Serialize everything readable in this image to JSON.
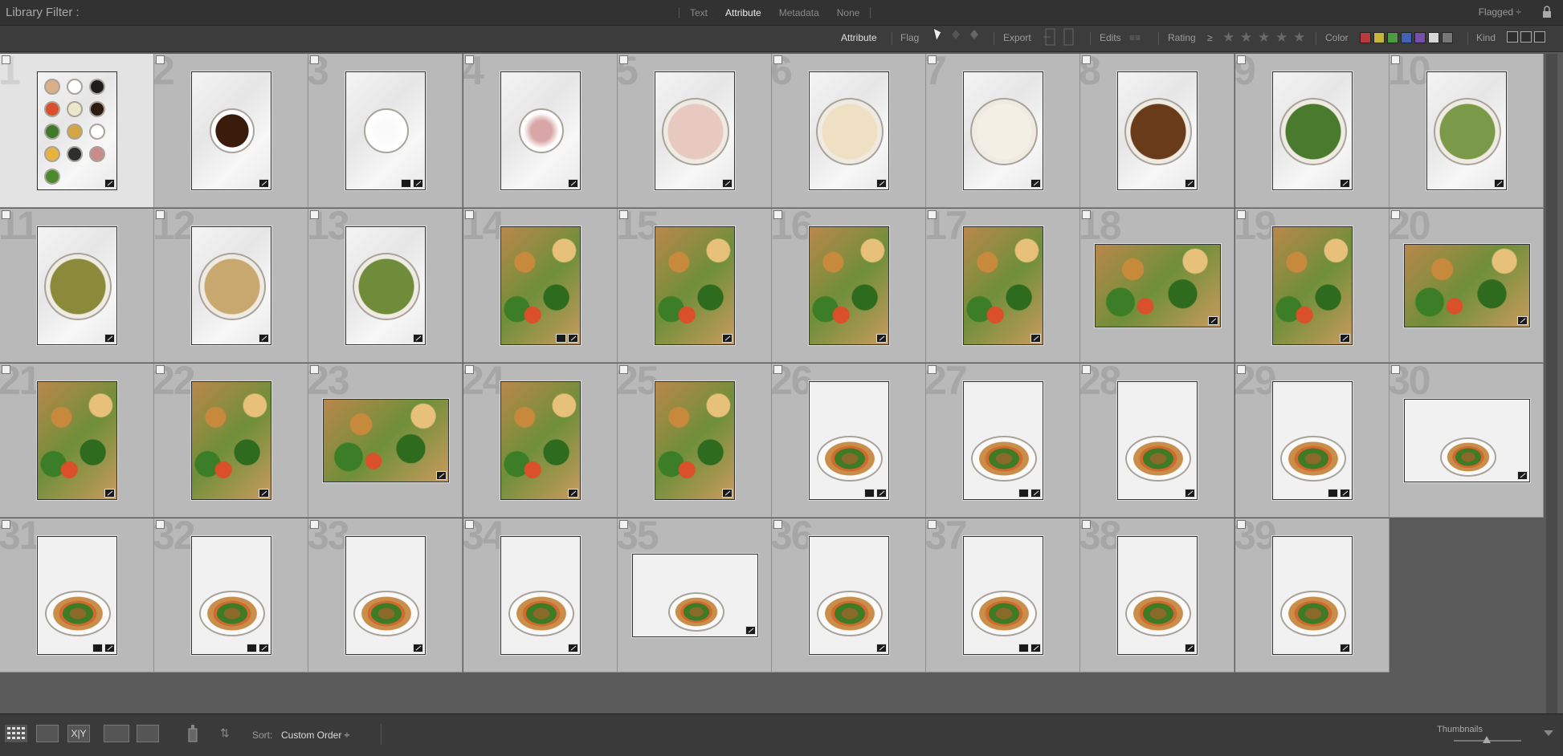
{
  "filter_bar": {
    "title": "Library Filter :",
    "tabs": [
      {
        "label": "Text",
        "active": false
      },
      {
        "label": "Attribute",
        "active": true
      },
      {
        "label": "Metadata",
        "active": false
      },
      {
        "label": "None",
        "active": false
      }
    ],
    "preset": "Flagged ÷"
  },
  "attribute_bar": {
    "label": "Attribute",
    "flag": "Flag",
    "export": "Export",
    "edits": "Edits",
    "rating": "Rating",
    "rating_op": "≥",
    "color": "Color",
    "kind": "Kind",
    "colors": [
      "#b73b3b",
      "#c9b43a",
      "#4e9a3f",
      "#3f63b5",
      "#7a4fa8",
      "#d6d6d6",
      "#777777"
    ]
  },
  "grid": {
    "cells": [
      {
        "n": "1",
        "kind": "ingredients",
        "selected": true
      },
      {
        "n": "2",
        "kind": "marble"
      },
      {
        "n": "3",
        "kind": "marble"
      },
      {
        "n": "4",
        "kind": "marble"
      },
      {
        "n": "5",
        "kind": "bowl"
      },
      {
        "n": "6",
        "kind": "bowl"
      },
      {
        "n": "7",
        "kind": "bowl"
      },
      {
        "n": "8",
        "kind": "bowl"
      },
      {
        "n": "9",
        "kind": "bowl"
      },
      {
        "n": "10",
        "kind": "bowl"
      },
      {
        "n": "11",
        "kind": "bowl"
      },
      {
        "n": "12",
        "kind": "bowl"
      },
      {
        "n": "13",
        "kind": "bowl"
      },
      {
        "n": "14",
        "kind": "food"
      },
      {
        "n": "15",
        "kind": "food"
      },
      {
        "n": "16",
        "kind": "food"
      },
      {
        "n": "17",
        "kind": "food"
      },
      {
        "n": "18",
        "kind": "food",
        "landscape": true
      },
      {
        "n": "19",
        "kind": "food"
      },
      {
        "n": "20",
        "kind": "food",
        "landscape": true
      },
      {
        "n": "21",
        "kind": "food"
      },
      {
        "n": "22",
        "kind": "food"
      },
      {
        "n": "23",
        "kind": "food",
        "landscape": true
      },
      {
        "n": "24",
        "kind": "food"
      },
      {
        "n": "25",
        "kind": "food"
      },
      {
        "n": "26",
        "kind": "plate"
      },
      {
        "n": "27",
        "kind": "plate"
      },
      {
        "n": "28",
        "kind": "plate"
      },
      {
        "n": "29",
        "kind": "plate"
      },
      {
        "n": "30",
        "kind": "plate",
        "landscape": true
      },
      {
        "n": "31",
        "kind": "plate"
      },
      {
        "n": "32",
        "kind": "plate"
      },
      {
        "n": "33",
        "kind": "plate"
      },
      {
        "n": "34",
        "kind": "plate"
      },
      {
        "n": "35",
        "kind": "plate",
        "landscape": true
      },
      {
        "n": "36",
        "kind": "plate"
      },
      {
        "n": "37",
        "kind": "plate"
      },
      {
        "n": "38",
        "kind": "plate"
      },
      {
        "n": "39",
        "kind": "plate"
      }
    ]
  },
  "toolbar": {
    "sort_label": "Sort:",
    "sort_value": "Custom Order ÷",
    "thumbnails_label": "Thumbnails"
  }
}
